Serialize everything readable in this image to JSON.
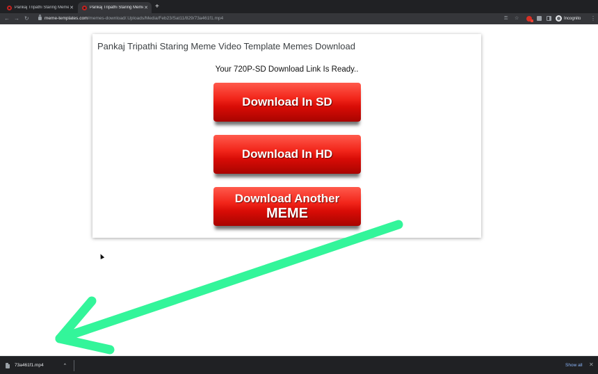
{
  "tabs": [
    {
      "title": "Pankaj Tripathi Staring Meme V",
      "close": "✕"
    },
    {
      "title": "Pankaj Tripathi Staring Meme V",
      "close": "✕"
    }
  ],
  "new_tab": "+",
  "toolbar": {
    "back": "←",
    "forward": "→",
    "reload": "↻",
    "url_host": "meme-templates.com",
    "url_path": "/memes-download/.Uploads/Media/Feb23/Sat11/829/73a461f1.mp4",
    "key_icon": "⚿",
    "star_icon": "☆",
    "incognito_label": "Incognito",
    "menu": "⋮"
  },
  "page": {
    "card_title": "Pankaj Tripathi Staring Meme Video Template Memes Download",
    "ready_text": "Your 720P-SD Download Link Is Ready..",
    "buttons": {
      "sd": "Download In SD",
      "hd": "Download In HD",
      "another_line1": "Download Another",
      "another_line2": "MEME"
    }
  },
  "download_shelf": {
    "file_name": "73a461f1.mp4",
    "chevron": "^",
    "show_all": "Show all",
    "close": "✕"
  },
  "colors": {
    "arrow": "#33f59a",
    "button_red": "#e8150b",
    "chrome_dark": "#202124"
  },
  "icons": [
    "back-icon",
    "forward-icon",
    "reload-icon",
    "lock-icon",
    "key-icon",
    "star-icon",
    "extension-icon",
    "puzzle-icon",
    "side-panel-icon",
    "incognito-avatar-icon",
    "menu-icon",
    "file-icon"
  ]
}
